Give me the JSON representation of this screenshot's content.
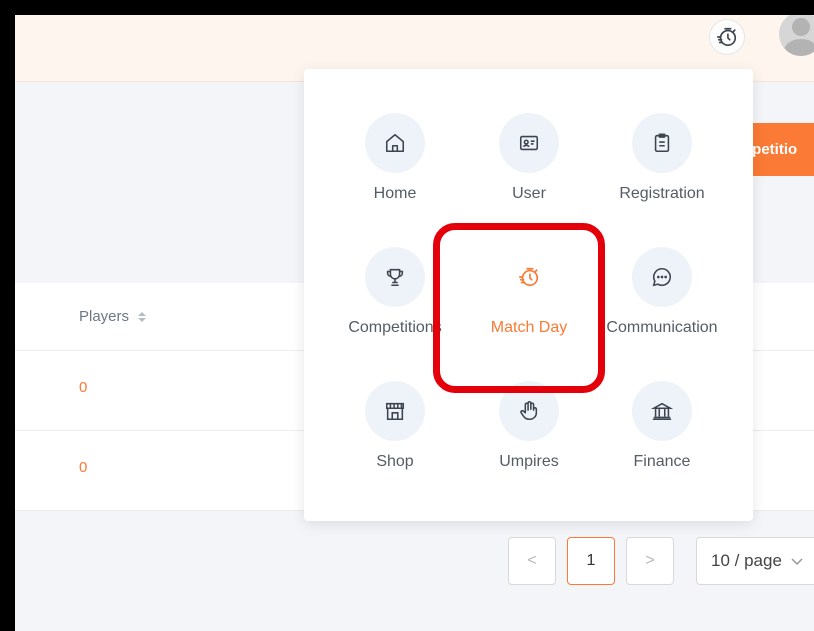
{
  "header": {
    "matchday_icon": "stopwatch-icon",
    "avatar_icon": "user-avatar",
    "competition_button_label": "npetitio"
  },
  "table": {
    "columns": [
      {
        "label": "Players",
        "sort_icon": "sort-icon"
      }
    ],
    "rows": [
      {
        "players": "0"
      },
      {
        "players": "0"
      }
    ]
  },
  "pagination": {
    "prev_symbol": "<",
    "current_page": "1",
    "next_symbol": ">",
    "page_size": "10 / page"
  },
  "app_menu": {
    "items": [
      {
        "label": "Home",
        "icon": "home-icon"
      },
      {
        "label": "User",
        "icon": "id-card-icon"
      },
      {
        "label": "Registration",
        "icon": "clipboard-icon"
      },
      {
        "label": "Competitions",
        "icon": "trophy-icon"
      },
      {
        "label": "Match Day",
        "icon": "stopwatch-icon",
        "active": true
      },
      {
        "label": "Communication",
        "icon": "chat-icon"
      },
      {
        "label": "Shop",
        "icon": "shop-icon"
      },
      {
        "label": "Umpires",
        "icon": "hand-icon"
      },
      {
        "label": "Finance",
        "icon": "bank-icon"
      }
    ]
  },
  "colors": {
    "accent": "#fb7a35",
    "highlight": "#e3000a",
    "icon_stroke": "#3d4550",
    "icon_bg": "#eef3f9"
  }
}
